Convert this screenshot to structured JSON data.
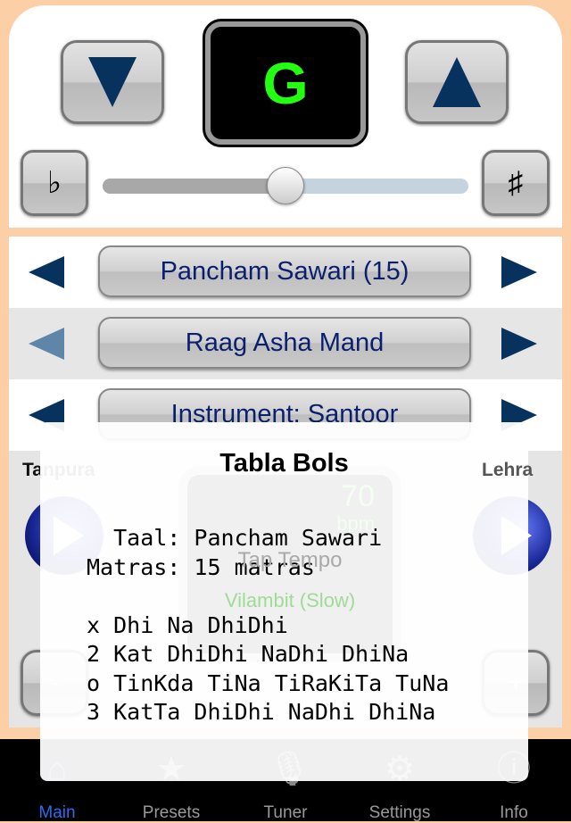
{
  "tuner": {
    "note": "G",
    "flat_label": "♭",
    "sharp_label": "♯",
    "pitch_slider_fraction": 0.5
  },
  "rows": [
    {
      "label": "Pancham Sawari (15)"
    },
    {
      "label": "Raag Asha Mand"
    },
    {
      "label": "Instrument: Santoor"
    }
  ],
  "lower": {
    "tanpura_label": "Tanpura",
    "lehra_label": "Lehra",
    "bpm": "70",
    "bpm_unit": "bpm",
    "tap_tempo": "Tap Tempo",
    "tempo_name": "Vilambit (Slow)",
    "minus": "-",
    "plus": "+"
  },
  "popup": {
    "title": "Tabla Bols",
    "lines": [
      "  Taal: Pancham Sawari",
      "Matras: 15 matras",
      "",
      "x Dhi Na DhiDhi",
      "2 Kat DhiDhi NaDhi DhiNa",
      "o TinKda TiNa TiRaKiTa TuNa",
      "3 KatTa DhiDhi NaDhi DhiNa"
    ]
  },
  "tabs": [
    {
      "label": "Main",
      "icon": "home-icon",
      "active": true
    },
    {
      "label": "Presets",
      "icon": "star-icon"
    },
    {
      "label": "Tuner",
      "icon": "microphone-icon"
    },
    {
      "label": "Settings",
      "icon": "gear-icon"
    },
    {
      "label": "Info",
      "icon": "info-icon"
    }
  ],
  "colors": {
    "accent": "#2a6cf0",
    "note": "#22ff10",
    "arrow": "#08325e",
    "background": "#fccfa6"
  }
}
